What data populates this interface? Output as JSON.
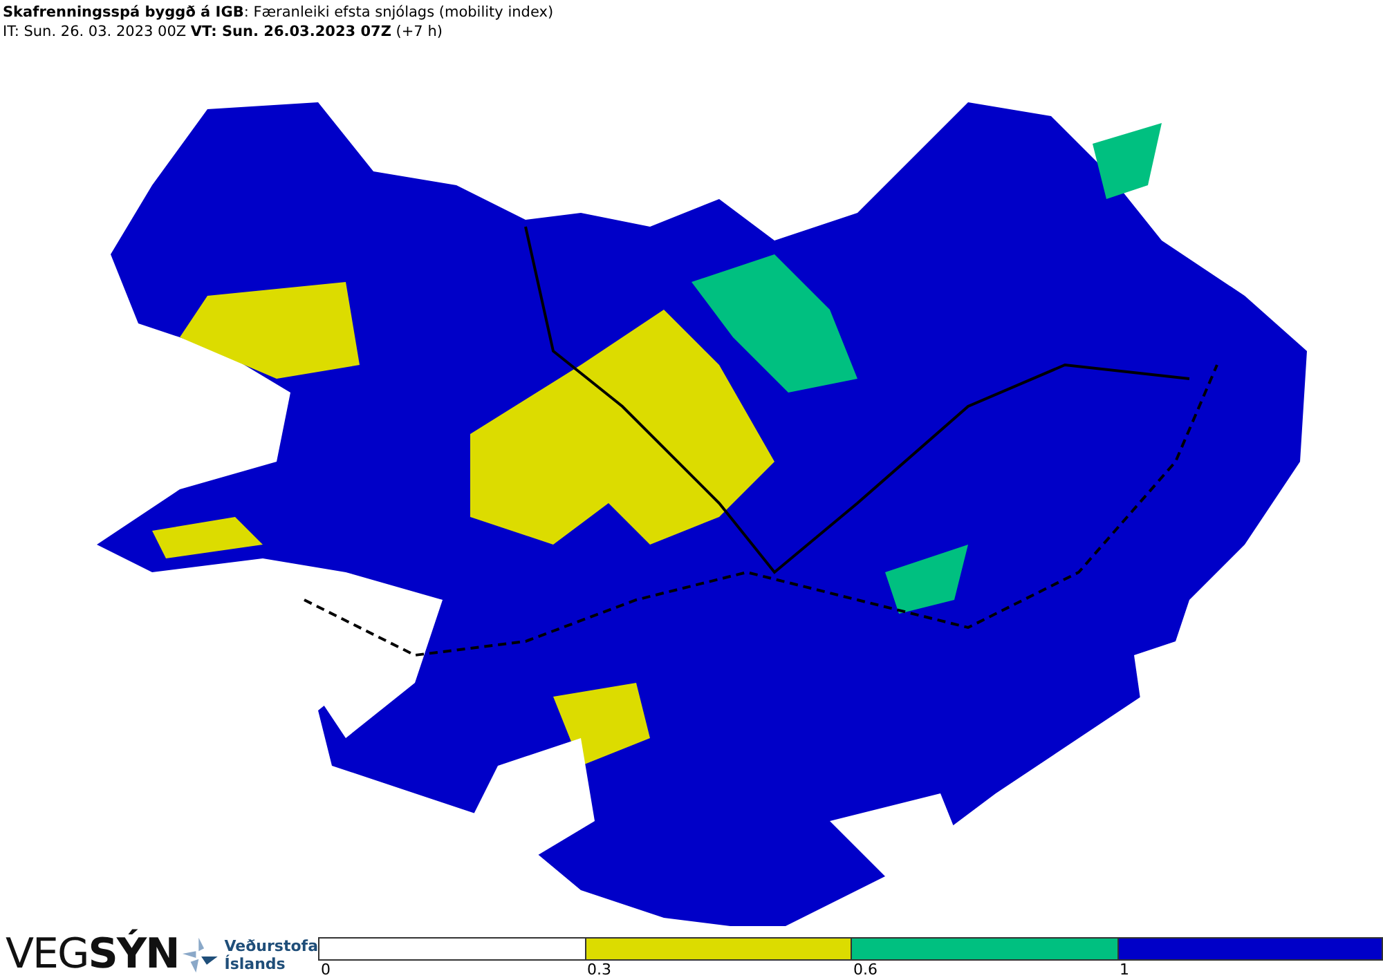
{
  "header": {
    "title": "**Skafrenningsspá byggð á IGB**: Færanleiki efsta snjólags (mobility index)",
    "times": "IT: Sun. 26. 03. 2023 00Z **VT: Sun. 26.03.2023 07Z** (+7 h)"
  },
  "footer": {
    "logo": "VEG**SÝN**",
    "agency_lines": [
      "Veðurstofa",
      "Íslands"
    ]
  },
  "legend": [
    {
      "label": "0",
      "color": "#ffffff"
    },
    {
      "label": "0.3",
      "color": "#dcdc00"
    },
    {
      "label": "0.6",
      "color": "#00c080"
    },
    {
      "label": "1",
      "color": "#0000c8"
    }
  ]
}
